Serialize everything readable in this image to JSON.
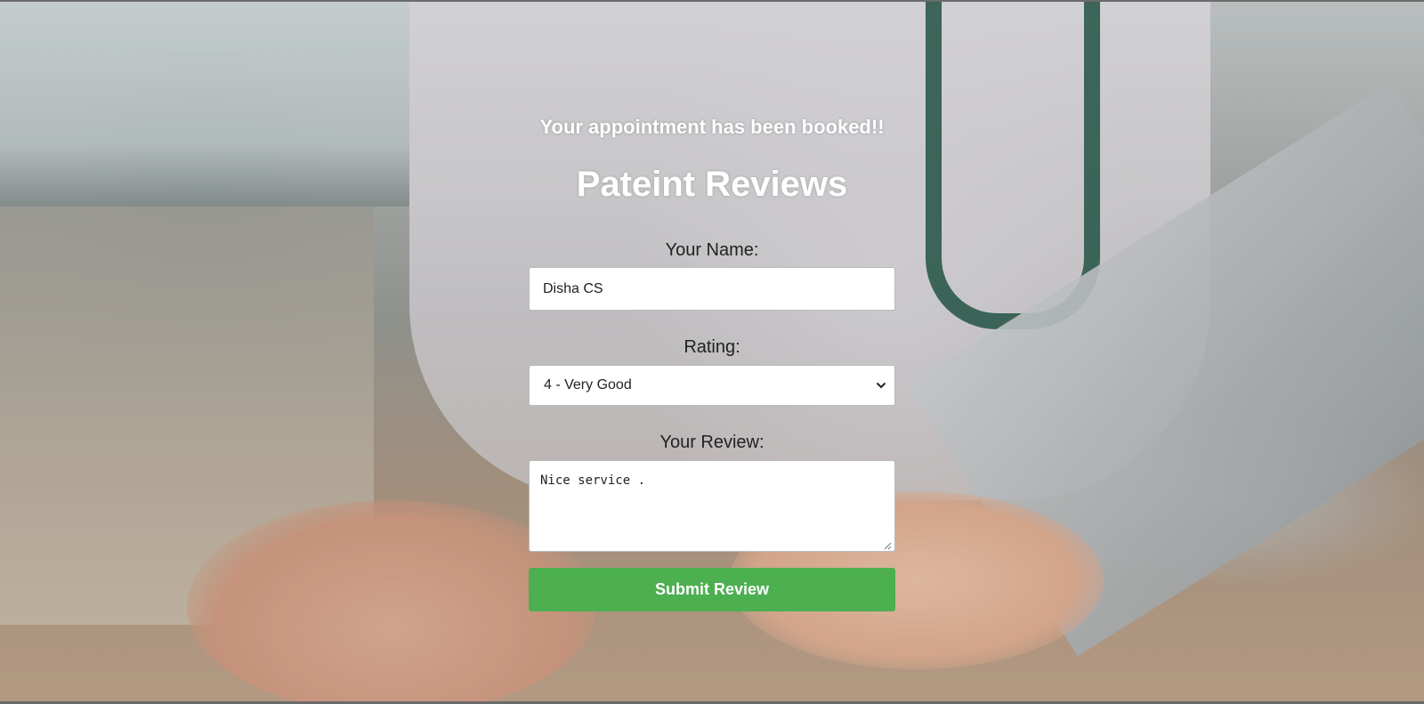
{
  "banner": {
    "text": "Your appointment has been booked!!"
  },
  "page": {
    "title": "Pateint Reviews"
  },
  "form": {
    "name_label": "Your Name:",
    "name_value": "Disha CS",
    "rating_label": "Rating:",
    "rating_selected": "4 - Very Good",
    "review_label": "Your Review:",
    "review_value": "Nice service .",
    "submit_label": "Submit Review"
  },
  "colors": {
    "submit_button": "#4caf50",
    "heading_text": "#ffffff"
  },
  "icons": {
    "select_arrow": "chevron-down-icon",
    "textarea_grip": "resize-grip-icon"
  }
}
